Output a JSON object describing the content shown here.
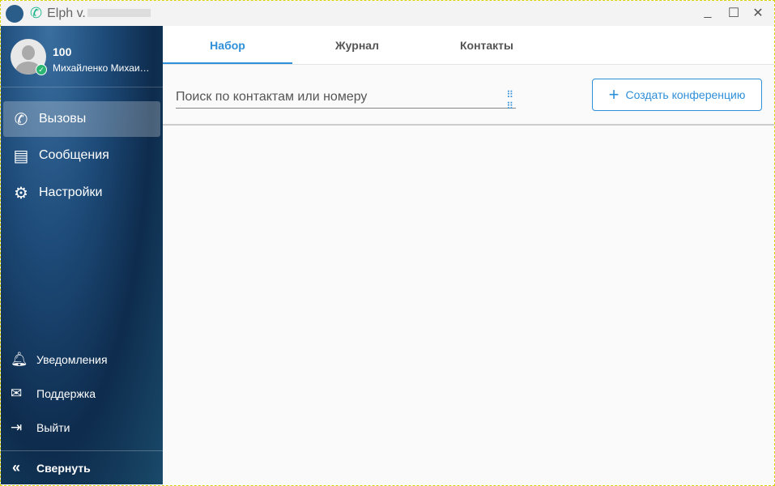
{
  "window": {
    "title": "Elph v.",
    "minimize": "_",
    "maximize": "☐",
    "close": "✕"
  },
  "profile": {
    "number": "100",
    "name": "Михайленко Михаи…",
    "status_color": "#2bb673"
  },
  "nav": [
    {
      "label": "Вызовы",
      "icon": "phone-icon",
      "active": true
    },
    {
      "label": "Сообщения",
      "icon": "message-icon"
    },
    {
      "label": "Настройки",
      "icon": "gear-icon"
    }
  ],
  "bottom": [
    {
      "label": "Уведомления",
      "icon": "bell-icon"
    },
    {
      "label": "Поддержка",
      "icon": "mail-icon"
    },
    {
      "label": "Выйти",
      "icon": "logout-icon"
    }
  ],
  "collapse": {
    "label": "Свернуть"
  },
  "tabs": [
    {
      "label": "Набор",
      "active": true
    },
    {
      "label": "Журнал"
    },
    {
      "label": "Контакты"
    }
  ],
  "search": {
    "placeholder": "Поиск по контактам или номеру"
  },
  "create_conference": {
    "label": "Создать конференцию"
  },
  "accent": "#2f8fd8"
}
